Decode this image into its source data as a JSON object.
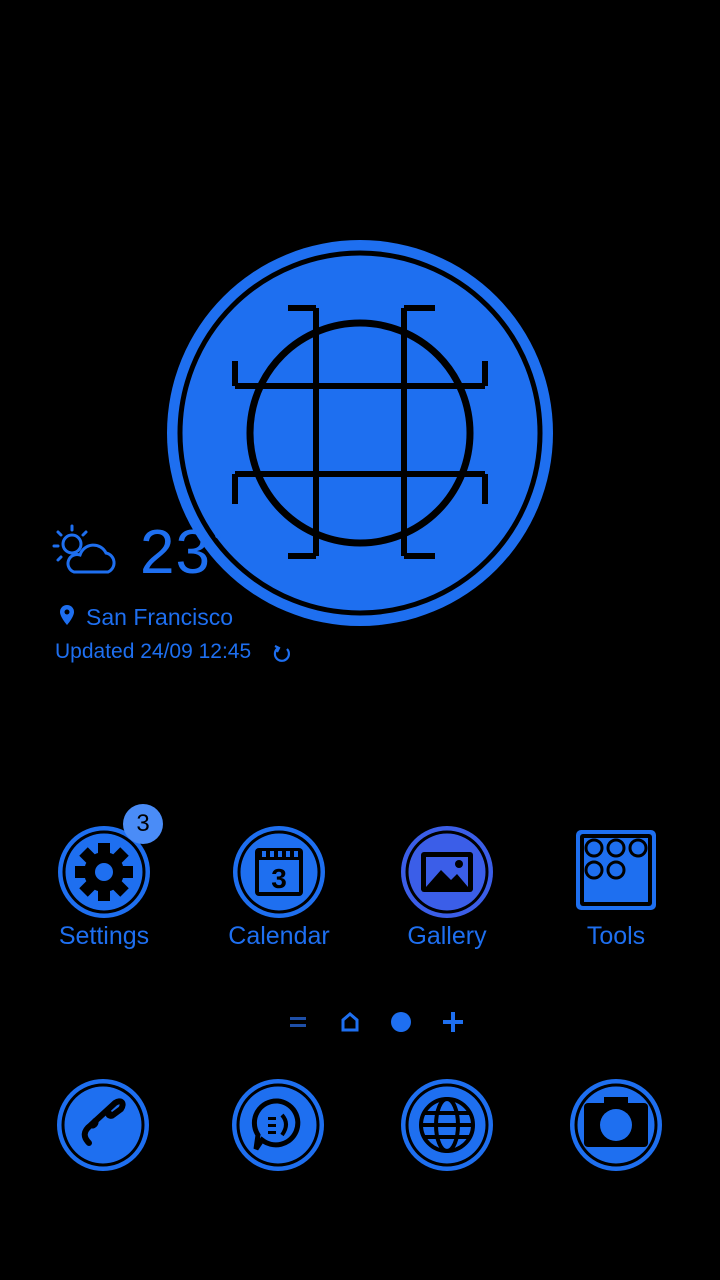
{
  "colors": {
    "accent": "#1e6ff0",
    "background": "#000000",
    "badge": "#4a8cf7",
    "gallery_fill": "#3b5ee8"
  },
  "weather": {
    "temperature": "23",
    "degree_symbol": "°",
    "location": "San Francisco",
    "updated": "Updated 24/09 12:45",
    "icon": "partly-sunny-icon"
  },
  "apps": [
    {
      "label": "Settings",
      "icon": "gear-icon",
      "badge": "3"
    },
    {
      "label": "Calendar",
      "icon": "calendar-icon",
      "day": "3"
    },
    {
      "label": "Gallery",
      "icon": "image-icon"
    },
    {
      "label": "Tools",
      "icon": "folder-icon"
    }
  ],
  "pager": {
    "pages": [
      "menu",
      "home",
      "current",
      "add"
    ],
    "active_index": 2
  },
  "dock": [
    {
      "icon": "phone-icon"
    },
    {
      "icon": "message-icon"
    },
    {
      "icon": "globe-icon"
    },
    {
      "icon": "camera-icon"
    }
  ]
}
